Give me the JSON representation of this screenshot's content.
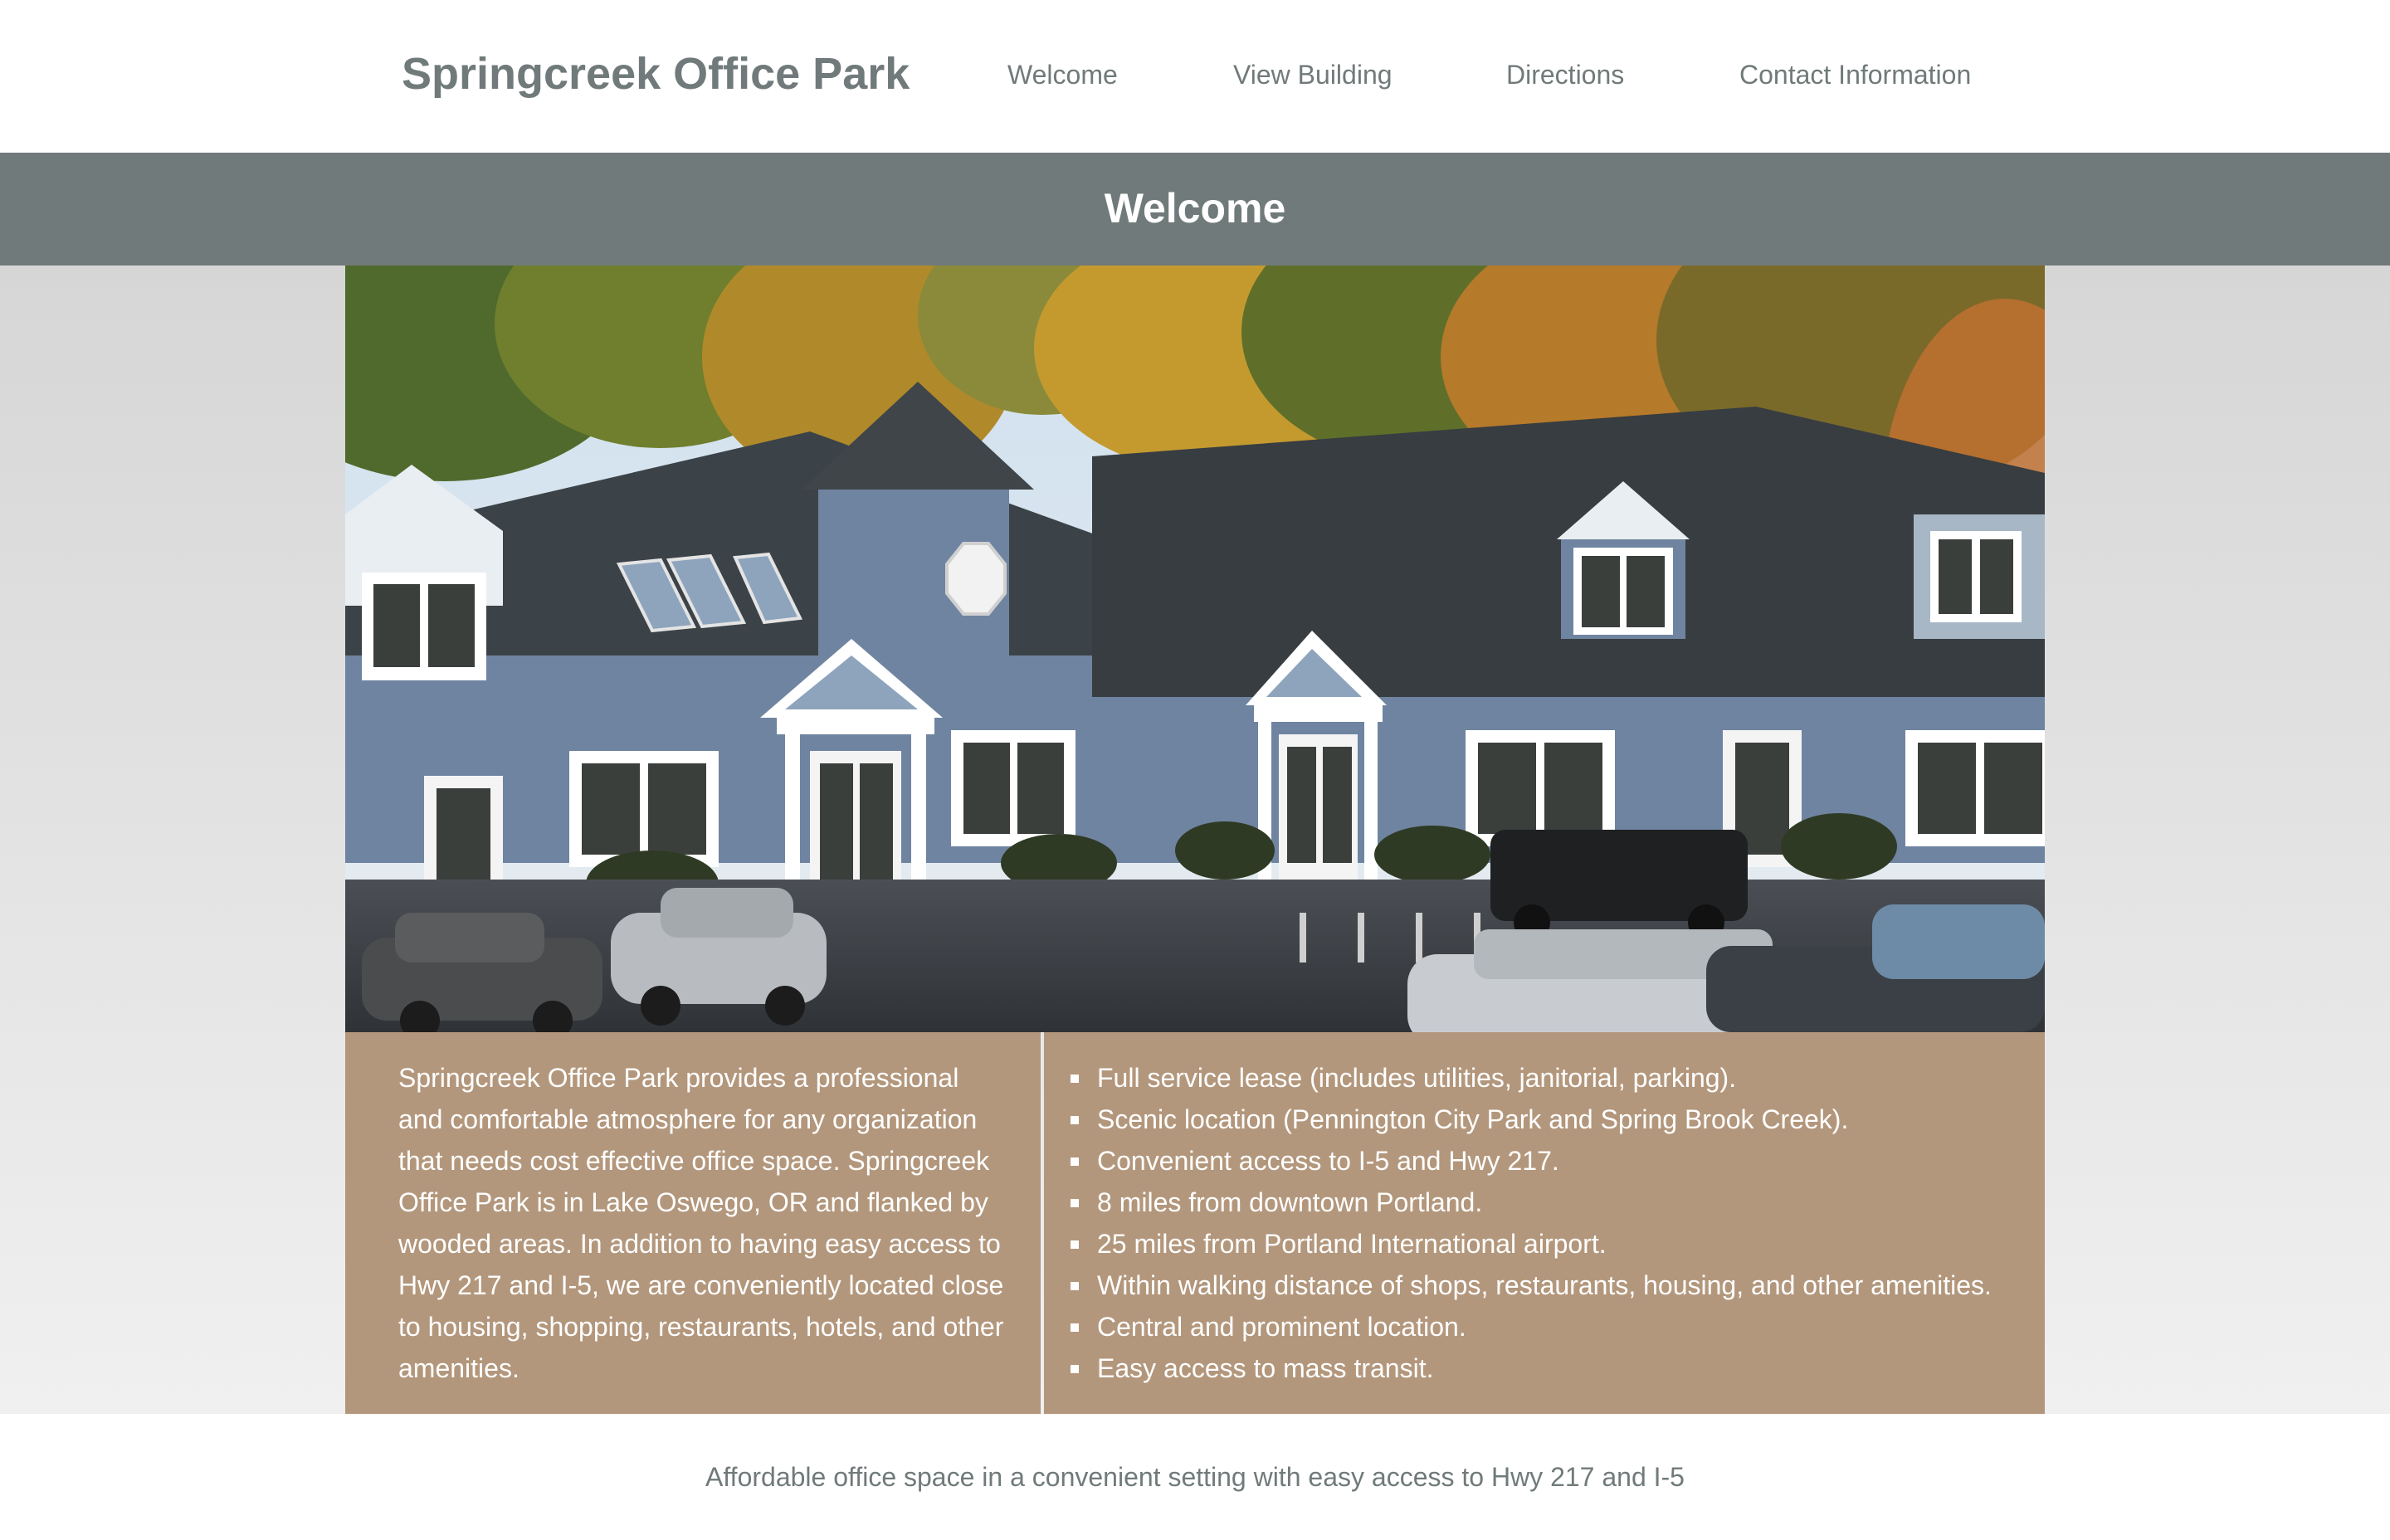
{
  "site": {
    "title": "Springcreek Office Park"
  },
  "nav": {
    "items": [
      {
        "label": "Welcome"
      },
      {
        "label": "View Building"
      },
      {
        "label": "Directions"
      },
      {
        "label": "Contact Information"
      }
    ]
  },
  "banner": {
    "title": "Welcome"
  },
  "intro": {
    "paragraph": "Springcreek Office Park provides a professional and comfortable atmosphere for any organization that needs cost effective office space. Springcreek Office Park is in Lake Oswego, OR and flanked by wooded areas. In addition to having easy access to Hwy 217 and I-5, we are conveniently located close to housing, shopping, restaurants, hotels, and other amenities."
  },
  "features": [
    "Full service lease (includes utilities, janitorial, parking).",
    "Scenic location (Pennington City Park and Spring Brook Creek).",
    "Convenient access to I-5 and Hwy 217.",
    "8 miles from downtown Portland.",
    "25 miles from Portland International airport.",
    "Within walking distance of shops, restaurants, housing, and other amenities.",
    "Central and prominent location.",
    "Easy access to mass transit."
  ],
  "footer": {
    "tagline": "Affordable office space in a convenient setting with easy access to Hwy 217 and I-5"
  },
  "colors": {
    "header_text": "#717a7a",
    "banner_bg": "#717a7a",
    "panel_bg": "#b3977c",
    "panel_text": "#ffffff"
  }
}
